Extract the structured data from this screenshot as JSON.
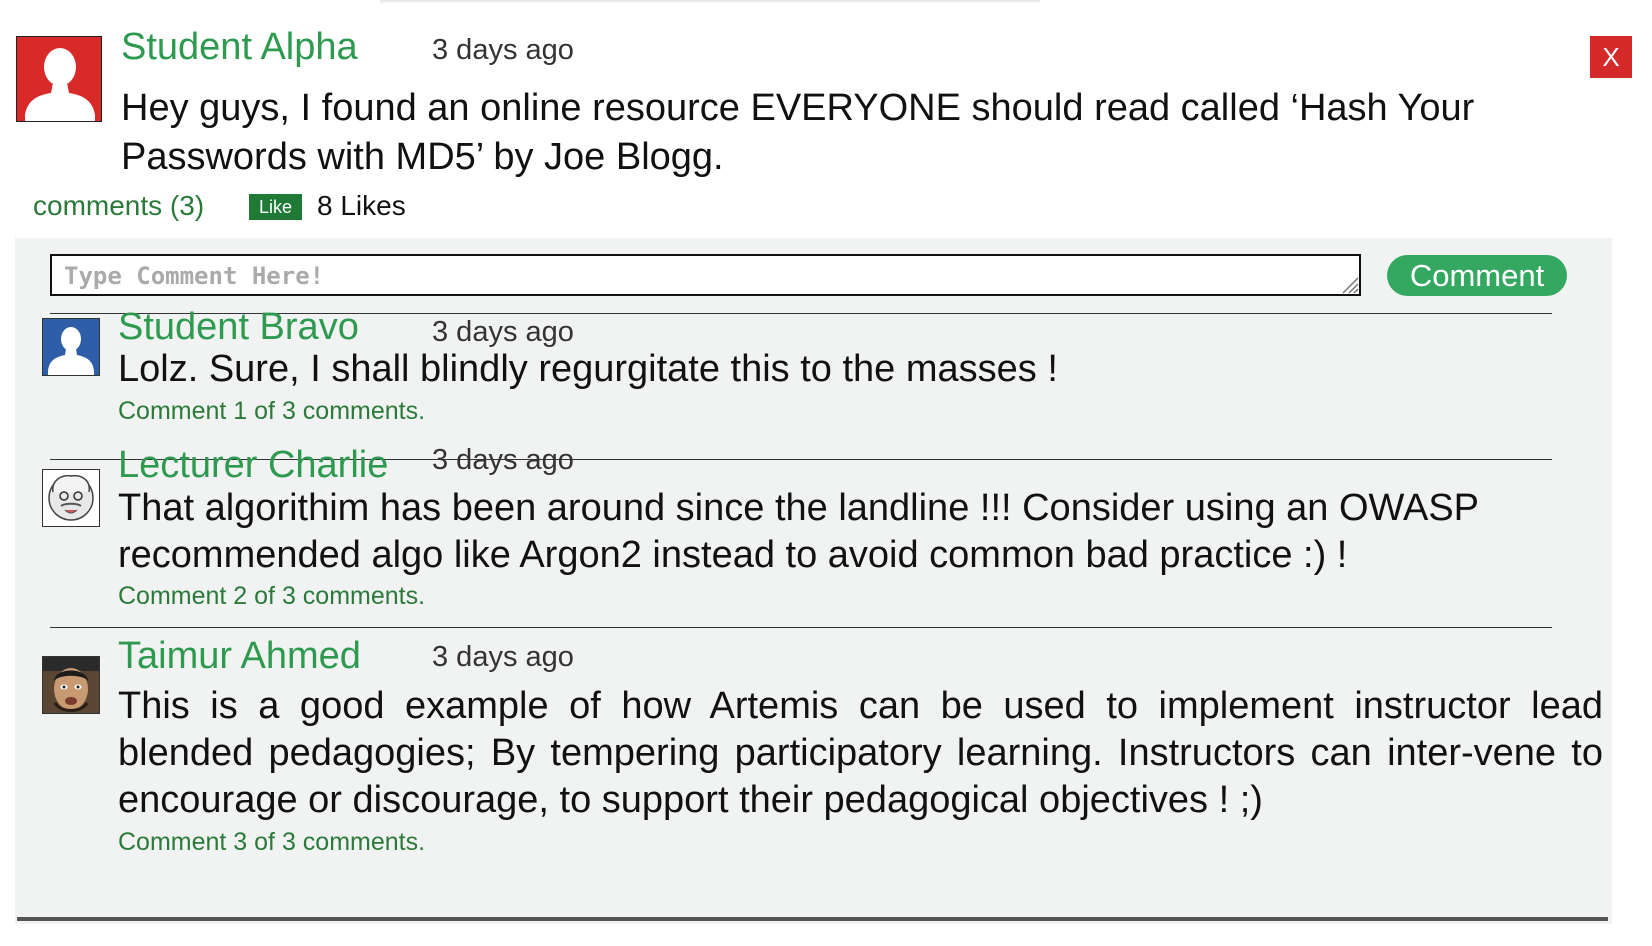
{
  "post": {
    "author": "Student Alpha",
    "time": "3 days ago",
    "body": "Hey guys, I found an online resource EVERYONE should read called ‘Hash Your Passwords with MD5’ by Joe Blogg.",
    "comments_link": "comments (3)",
    "like_label": "Like",
    "likes_count": "8 Likes",
    "close_label": "X"
  },
  "composer": {
    "placeholder": "Type Comment Here!",
    "value": "",
    "submit_label": "Comment"
  },
  "comments": [
    {
      "author": "Student Bravo",
      "time": "3 days ago",
      "text": "Lolz. Sure, I shall blindly regurgitate this to the masses !",
      "position": "Comment 1 of 3 comments."
    },
    {
      "author": "Lecturer Charlie",
      "time": "3 days ago",
      "text": "That algorithim has been around since the landline !!! Consider using an OWASP recommended algo like Argon2 instead to avoid common bad practice :) !",
      "position": "Comment 2 of 3 comments."
    },
    {
      "author": "Taimur Ahmed",
      "time": "3 days ago",
      "text": "This is a good example of how Artemis can be used to implement instructor lead blended pedagogies; By tempering participatory learning. Instructors can inter-vene to encourage or discourage, to support their pedagogical objectives ! ;)",
      "position": "Comment 3 of 3 comments."
    }
  ],
  "colors": {
    "author_green": "#2e9a4f",
    "link_green": "#2b7a3a",
    "button_green": "#34a861",
    "close_red": "#d42a2a"
  },
  "icons": {
    "post_avatar": "default-user-silhouette-red",
    "bravo_avatar": "default-user-silhouette-blue",
    "charlie_avatar": "cartoon-scientist-avatar",
    "taimur_avatar": "profile-photo",
    "close": "close-x-icon",
    "resize": "resize-grip-icon"
  }
}
